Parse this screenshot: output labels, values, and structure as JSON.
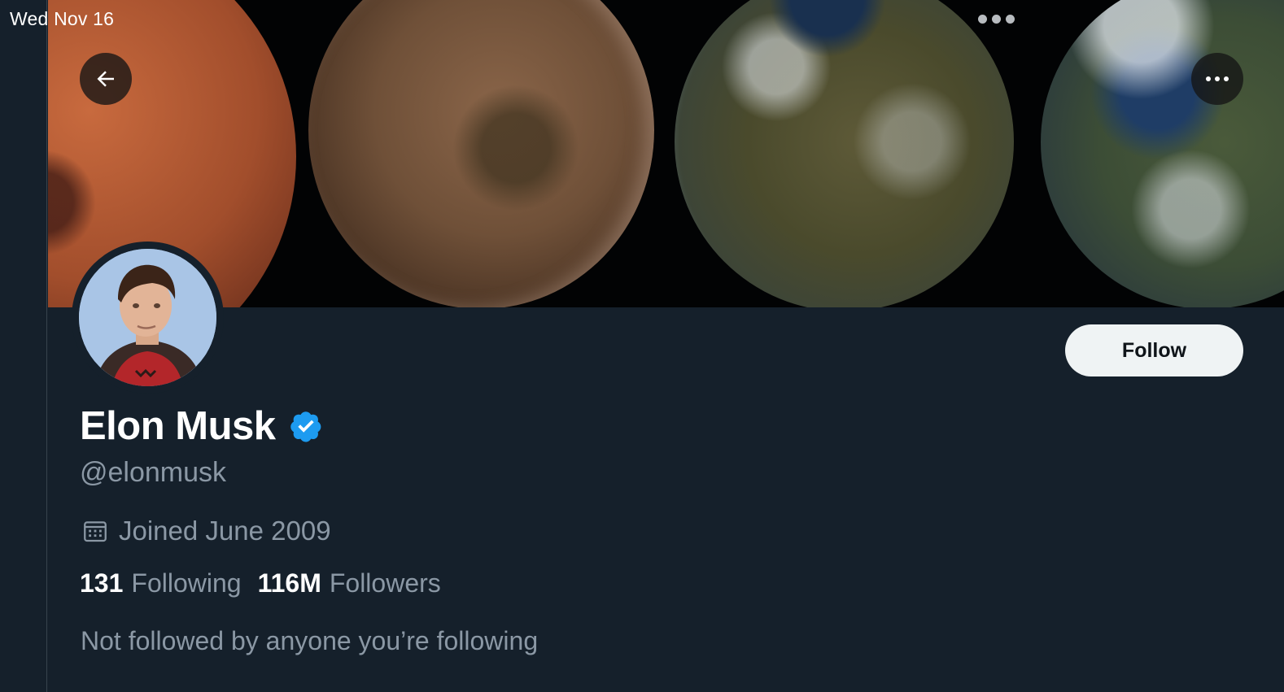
{
  "status_bar": {
    "date": "Wed Nov 16"
  },
  "header": {
    "back_icon": "arrow-left-icon",
    "more_icon": "more-horizontal-icon"
  },
  "profile": {
    "display_name": "Elon Musk",
    "verified": true,
    "handle": "@elonmusk",
    "joined": "Joined June 2009",
    "following_count": "131",
    "following_label": "Following",
    "followers_count": "116M",
    "followers_label": "Followers",
    "mutuals_note": "Not followed by anyone you’re following"
  },
  "actions": {
    "follow_label": "Follow"
  },
  "colors": {
    "background": "#15202b",
    "verified_badge": "#1d9bf0",
    "follow_button_bg": "#eff3f4",
    "secondary_text": "#8b98a5"
  }
}
